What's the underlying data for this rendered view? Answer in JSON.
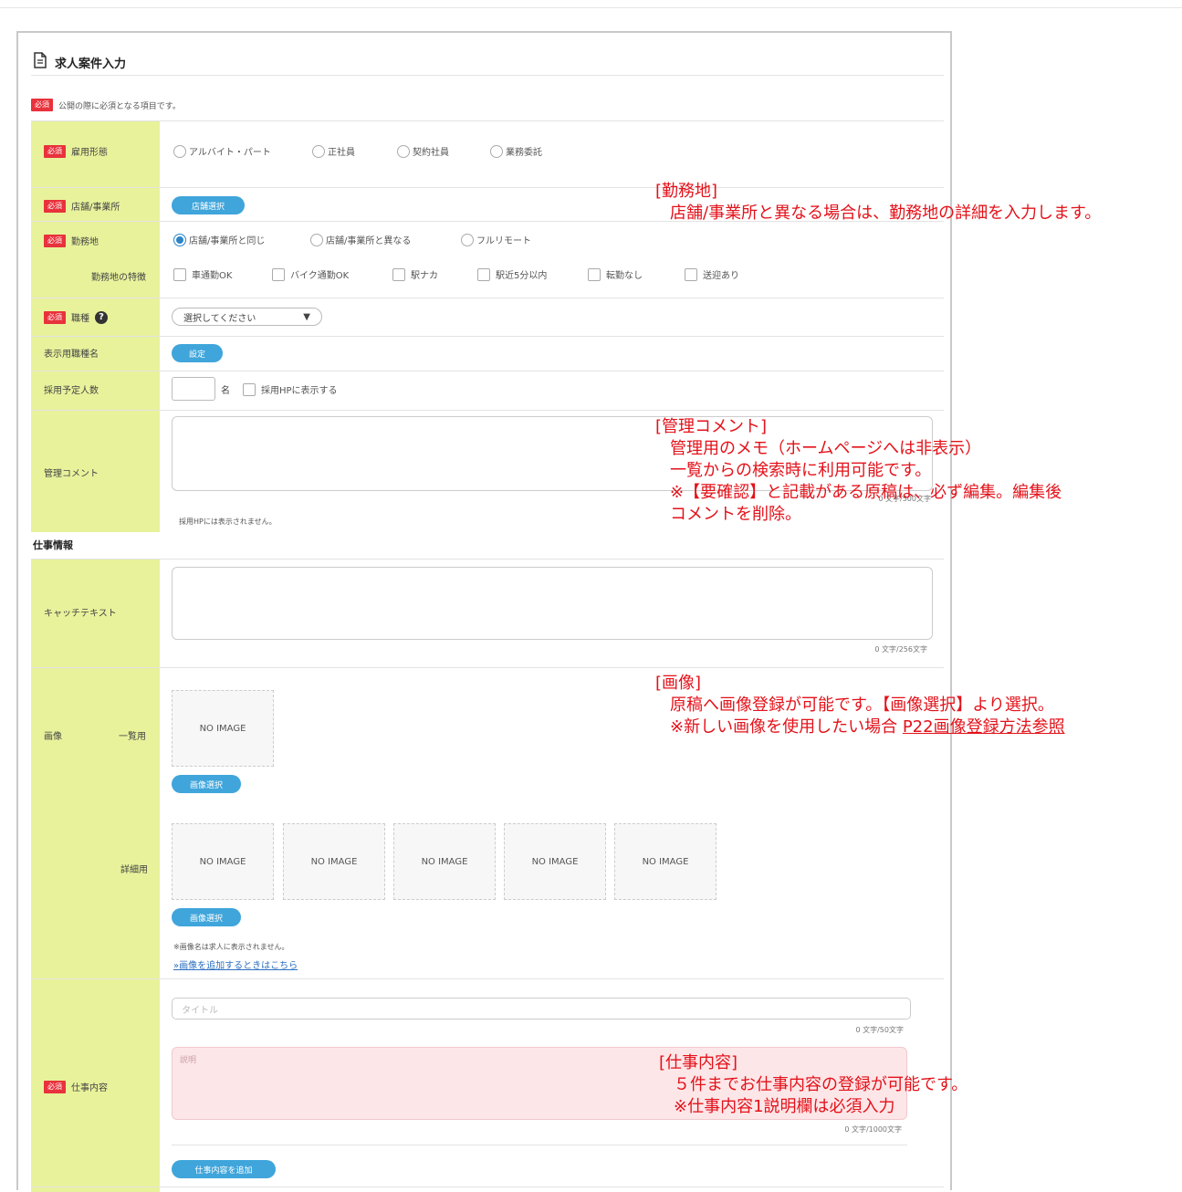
{
  "page": {
    "title": "求人案件入力",
    "required_note": "公開の際に必須となる項目です。"
  },
  "required_badge": "必須",
  "fields": {
    "employment_type": {
      "label": "雇用形態",
      "options": [
        "アルバイト・パート",
        "正社員",
        "契約社員",
        "業務委託"
      ]
    },
    "store": {
      "label": "店舗/事業所",
      "button": "店舗選択"
    },
    "workplace": {
      "label": "勤務地",
      "options": [
        "店舗/事業所と同じ",
        "店舗/事業所と異なる",
        "フルリモート"
      ],
      "selected": "店舗/事業所と同じ"
    },
    "workplace_features": {
      "label": "勤務地の特徴",
      "options": [
        "車通勤OK",
        "バイク通勤OK",
        "駅ナカ",
        "駅近5分以内",
        "転勤なし",
        "送迎あり"
      ]
    },
    "job_type": {
      "label": "職種",
      "placeholder": "選択してください",
      "arrow": "▼",
      "help": "?"
    },
    "display_job_name": {
      "label": "表示用職種名",
      "button": "設定"
    },
    "headcount": {
      "label": "採用予定人数",
      "unit": "名",
      "checkbox": "採用HPに表示する"
    },
    "admin_comment": {
      "label": "管理コメント",
      "counter": "0 文字/500文字",
      "note": "採用HPには表示されません。"
    }
  },
  "work_info": {
    "section_title": "仕事情報",
    "catch_text": {
      "label": "キャッチテキスト",
      "counter": "0 文字/256文字"
    },
    "images": {
      "label": "画像",
      "list_label": "一覧用",
      "detail_label": "詳細用",
      "placeholder": "NO IMAGE",
      "select_button": "画像選択",
      "note": "※画像名は求人に表示されません。",
      "add_link": "»画像を追加するときはこちら"
    },
    "job_content": {
      "label": "仕事内容",
      "title_placeholder": "タイトル",
      "title_counter": "0 文字/50文字",
      "desc_placeholder": "説明",
      "desc_counter": "0 文字/1000文字",
      "add_button": "仕事内容を追加"
    }
  },
  "annotations": {
    "workplace": {
      "head": "[勤務地]",
      "line1": "店舗/事業所と異なる場合は、勤務地の詳細を入力します。"
    },
    "admin": {
      "head": "[管理コメント]",
      "line1": "管理用のメモ（ホームページへは非表示）",
      "line2": "一覧からの検索時に利用可能です。",
      "line3": "※【要確認】と記載がある原稿は、必ず編集。編集後",
      "line4": "コメントを削除。"
    },
    "image": {
      "head": "[画像]",
      "line1": "原稿へ画像登録が可能です。【画像選択】より選択。",
      "line2a": "※新しい画像を使用したい場合",
      "line2b": "P22画像登録方法参照"
    },
    "job": {
      "head": "[仕事内容]",
      "line1": "５件までお仕事内容の登録が可能です。",
      "line2": "※仕事内容1説明欄は必須入力"
    }
  },
  "colors": {
    "label_bg": "#e8f29b",
    "required": "#e8323c",
    "accent": "#3fa5db",
    "annotation": "#e3121a",
    "desc_bg": "#fde6e8"
  }
}
